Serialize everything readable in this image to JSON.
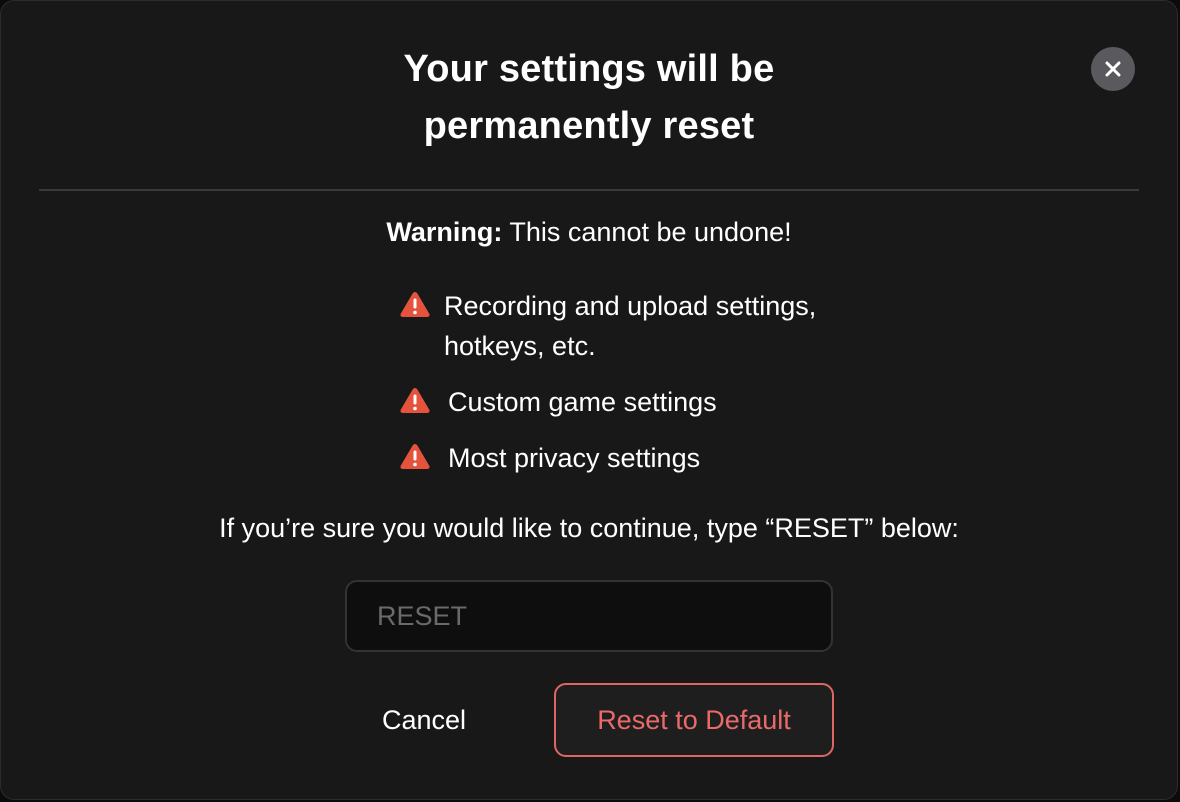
{
  "dialog": {
    "title_line1": "Your settings will be",
    "title_line2": "permanently reset",
    "close_icon": "close-icon",
    "warning_label": "Warning:",
    "warning_text": " This cannot be undone!",
    "items": [
      {
        "icon": "warning-triangle-icon",
        "label": "Recording and upload settings, hotkeys, etc."
      },
      {
        "icon": "warning-triangle-icon",
        "label": "Custom game settings"
      },
      {
        "icon": "warning-triangle-icon",
        "label": "Most privacy settings"
      }
    ],
    "instruction": "If you’re sure you would like to continue, type “RESET” below:",
    "input": {
      "placeholder": "RESET",
      "value": ""
    },
    "cancel_label": "Cancel",
    "reset_label": "Reset to Default"
  },
  "colors": {
    "background": "#181818",
    "danger": "#e5533d",
    "danger_button": "#e06666",
    "close_button": "#5a5a5e"
  }
}
